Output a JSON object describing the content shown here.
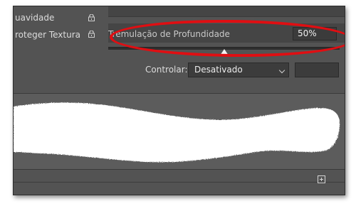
{
  "brush_panel": {
    "options": [
      {
        "label": "uavidade",
        "lock_icon": "lock-icon"
      },
      {
        "label": "roteger Textura",
        "lock_icon": "lock-icon"
      }
    ],
    "depth_jitter": {
      "label": "Tremulação de Profundidade",
      "value": "50%",
      "slider_level_percent": 50
    },
    "control": {
      "label": "Controlar:",
      "selected": "Desativado",
      "chevron_icon": "chevron-down-icon"
    },
    "footer": {
      "add_icon": "add-square-icon"
    }
  },
  "colors": {
    "panel_bg": "#535353",
    "highlight": "#e00e12",
    "stroke": "#ffffff"
  }
}
